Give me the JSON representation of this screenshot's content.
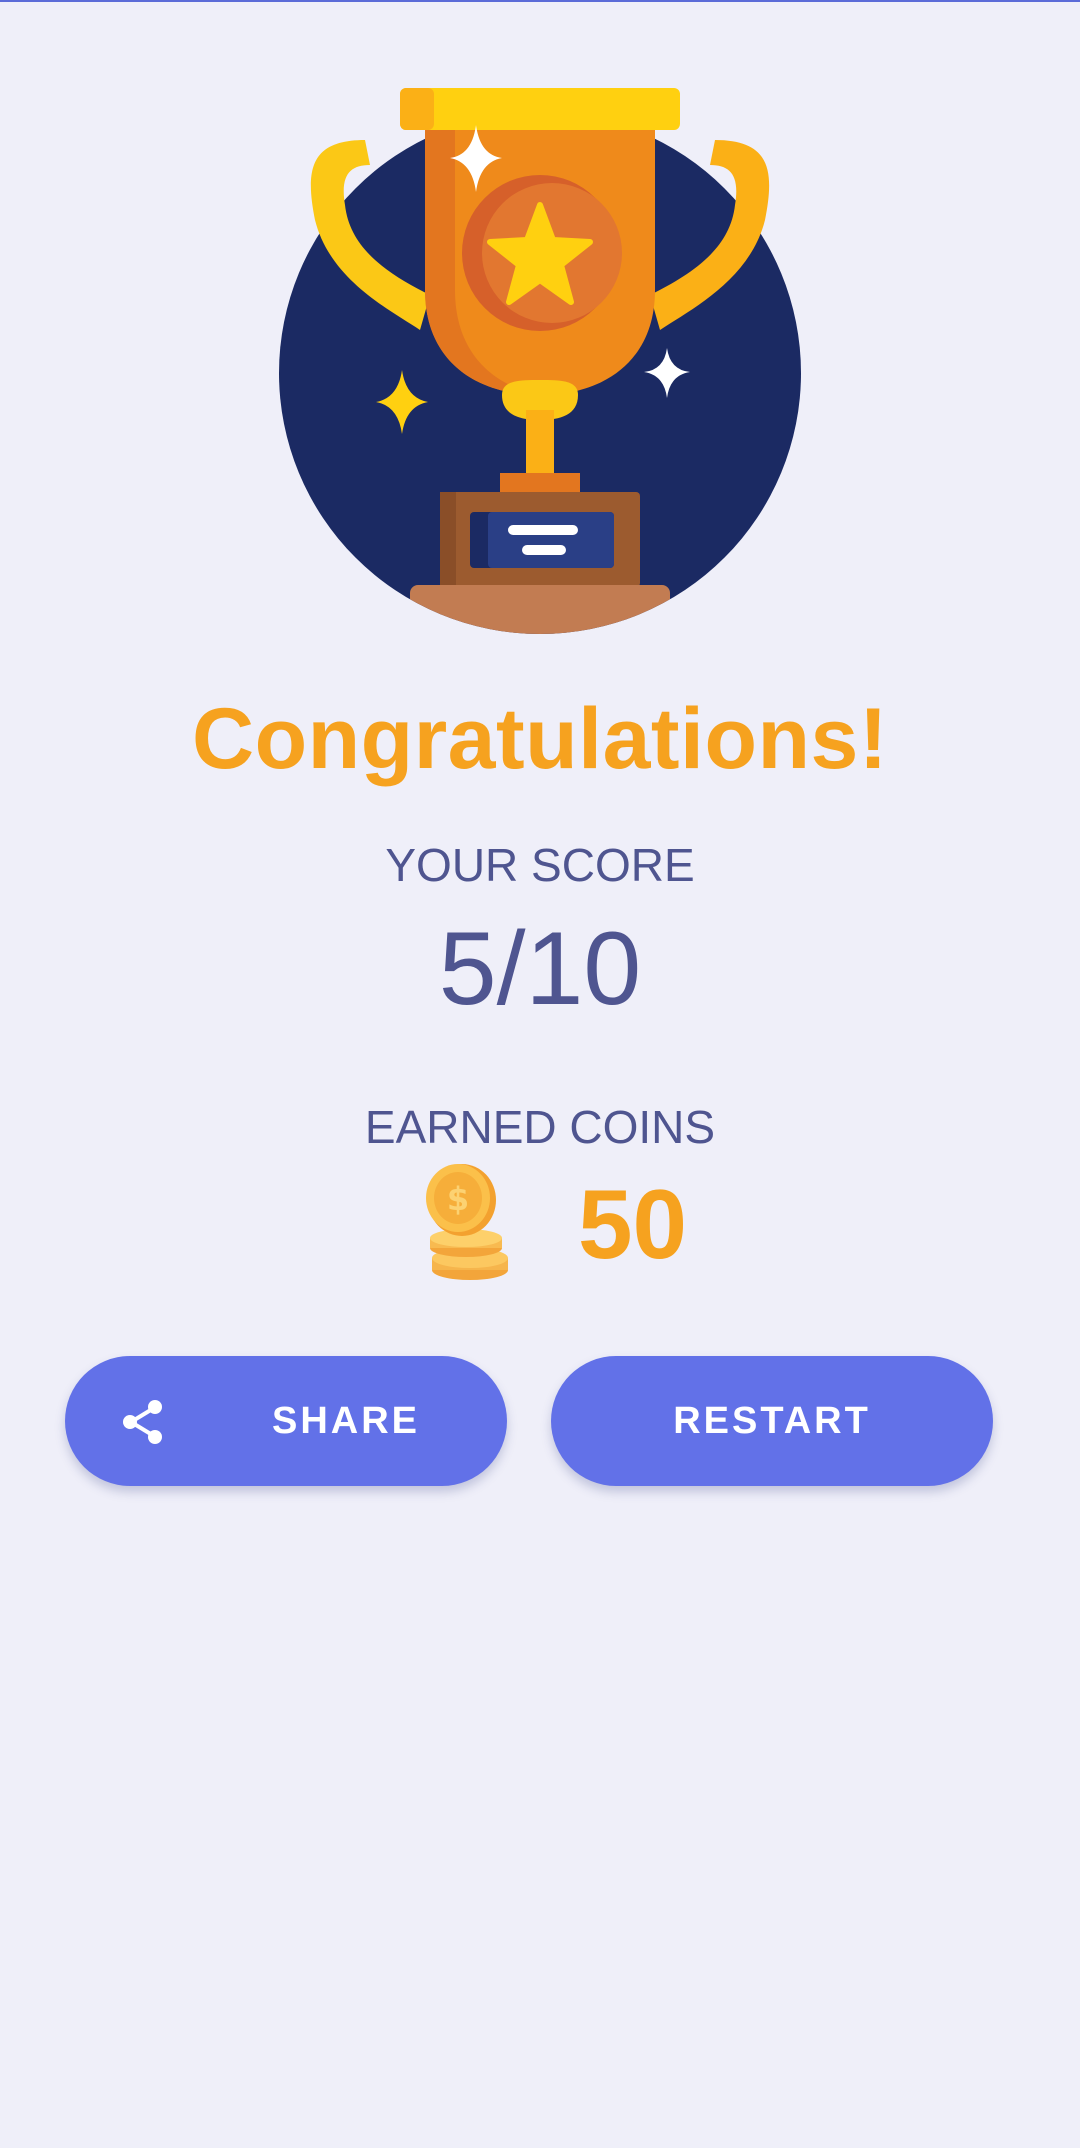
{
  "screen": {
    "title": "Congratulations!",
    "score_label": "YOUR SCORE",
    "score_value": "5/10",
    "coins_label": "EARNED COINS",
    "coins_value": "50"
  },
  "buttons": {
    "share_label": "SHARE",
    "restart_label": "RESTART"
  },
  "icons": {
    "trophy": "trophy-icon",
    "coins": "coin-stack-icon",
    "share": "share-icon"
  },
  "colors": {
    "background": "#EFEFF9",
    "accent_orange": "#F6A21F",
    "text_indigo": "#4F5590",
    "button": "#6271E8",
    "trophy_circle": "#1B2A63"
  }
}
